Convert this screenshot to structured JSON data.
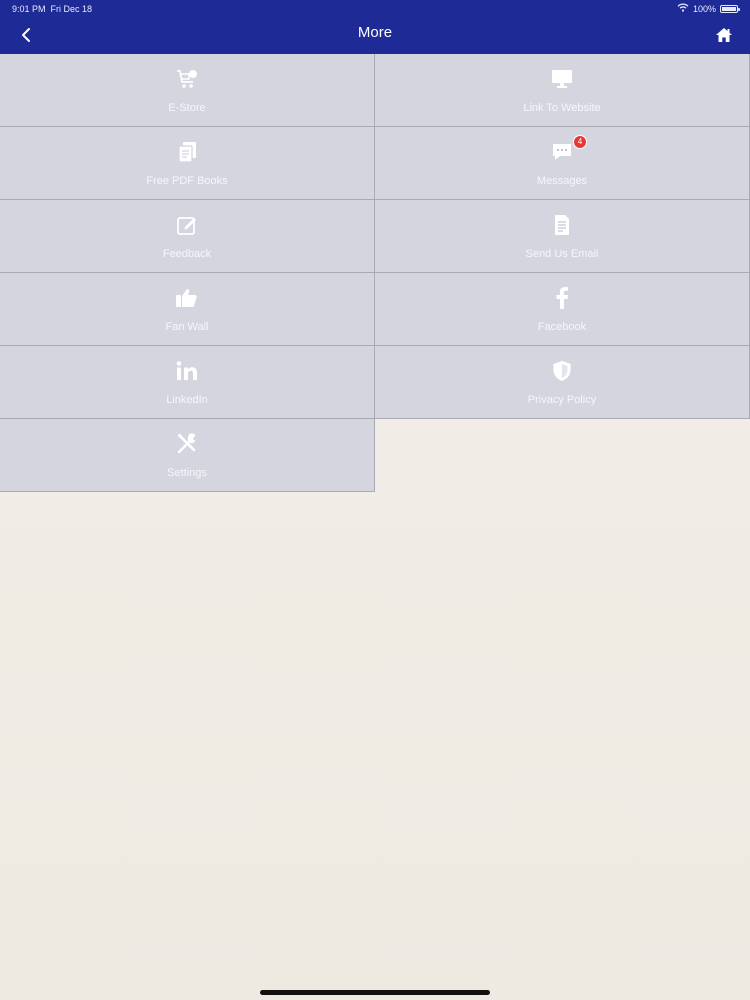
{
  "status_bar": {
    "time": "9:01 PM",
    "date": "Fri Dec 18",
    "battery": "100%",
    "battery_level": 1.0
  },
  "header": {
    "title": "More",
    "back_icon": "chevron-left-icon",
    "home_icon": "home-icon"
  },
  "menu": [
    {
      "label": "E-Store",
      "icon": "store-cart-icon"
    },
    {
      "label": "Link To Website",
      "icon": "monitor-icon"
    },
    {
      "label": "Free PDF Books",
      "icon": "documents-icon"
    },
    {
      "label": "Messages",
      "icon": "chat-bubble-icon",
      "badge": "4"
    },
    {
      "label": "Feedback",
      "icon": "edit-icon"
    },
    {
      "label": "Send Us Email",
      "icon": "email-document-icon"
    },
    {
      "label": "Fan Wall",
      "icon": "thumbs-up-icon"
    },
    {
      "label": "Facebook",
      "icon": "facebook-icon"
    },
    {
      "label": "LinkedIn",
      "icon": "linkedin-icon"
    },
    {
      "label": "Privacy Policy",
      "icon": "shield-icon"
    },
    {
      "label": "Settings",
      "icon": "tools-icon"
    }
  ],
  "colors": {
    "header": "#1e2a96",
    "tile": "#d2d3de",
    "badge": "#e53935",
    "background": "#f1ede6"
  }
}
